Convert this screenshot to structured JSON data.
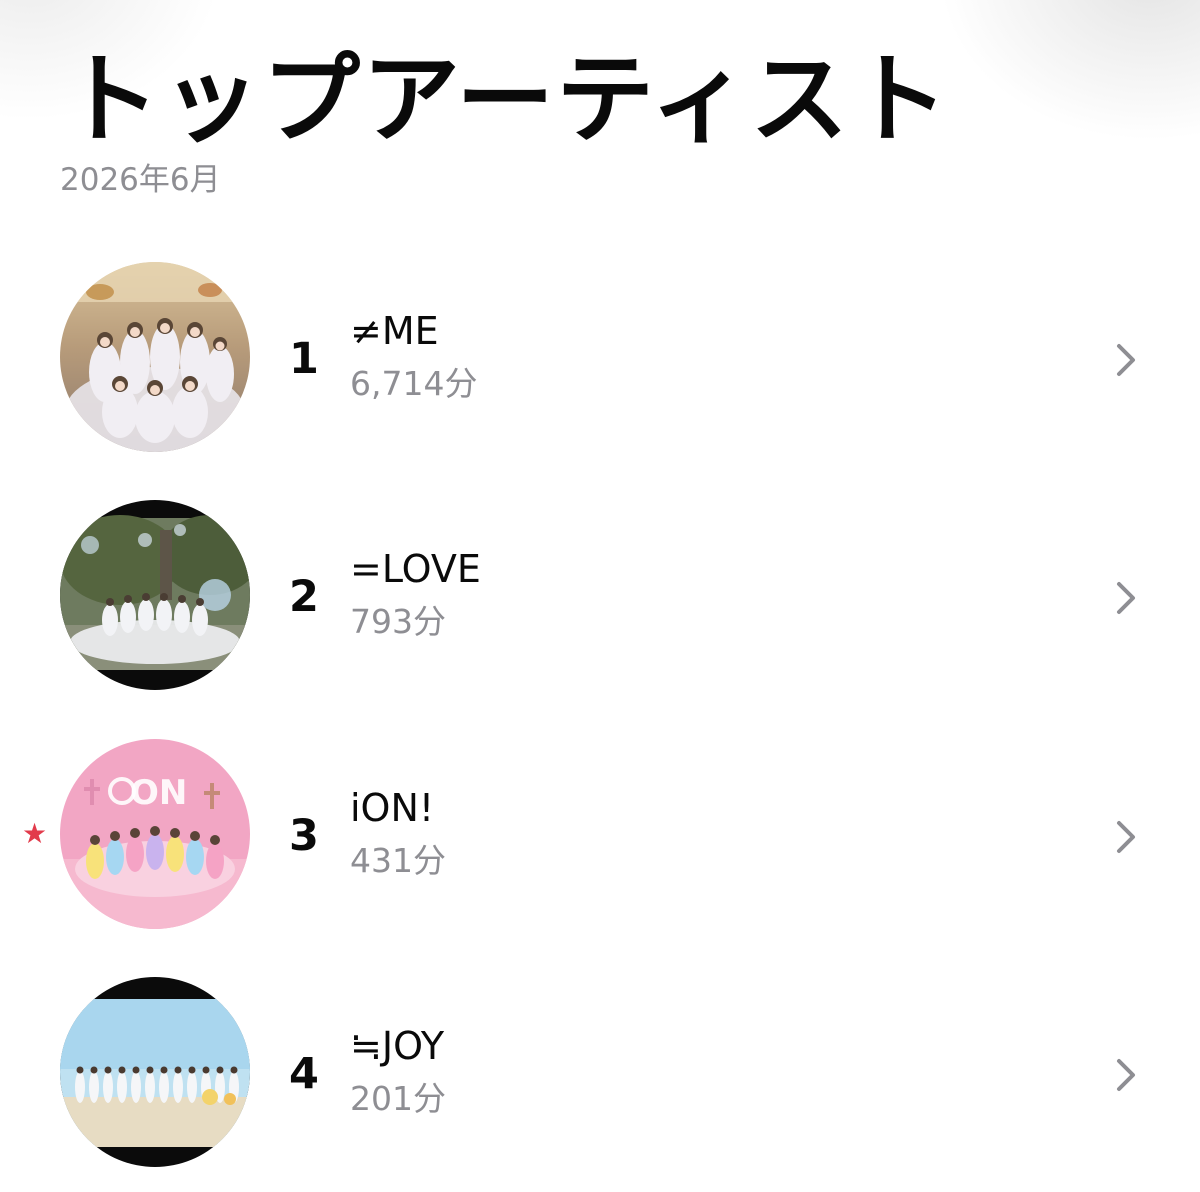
{
  "header": {
    "title": "トップアーティスト",
    "period": "2026年6月"
  },
  "artists": [
    {
      "rank": "1",
      "name": "≠ME",
      "minutes": "6,714分",
      "image_icon": "artist-photo-group-icon"
    },
    {
      "rank": "2",
      "name": "=LOVE",
      "minutes": "793分",
      "image_icon": "artist-photo-group-icon"
    },
    {
      "rank": "3",
      "name": "iON!",
      "minutes": "431分",
      "image_icon": "artist-photo-group-icon",
      "marker": "★",
      "marker_color": "#e23b4b"
    },
    {
      "rank": "4",
      "name": "≒JOY",
      "minutes": "201分",
      "image_icon": "artist-photo-group-icon"
    }
  ],
  "colors": {
    "text_primary": "#0a0a0a",
    "text_secondary": "#8e8e93",
    "chevron": "#8e8e93",
    "background": "#ffffff"
  },
  "icons": {
    "row_disclosure": "chevron-right-icon",
    "highlight_marker": "star-icon"
  }
}
